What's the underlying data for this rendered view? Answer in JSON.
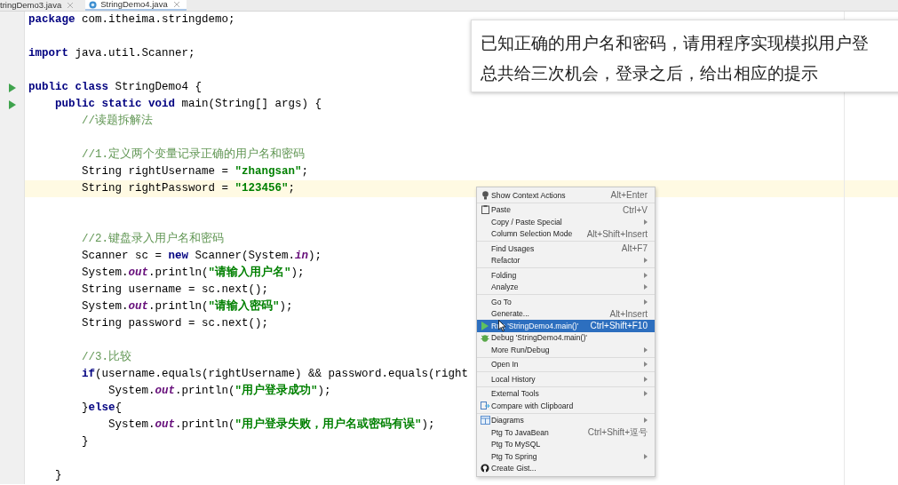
{
  "tabs": [
    {
      "label": "tringDemo3.java",
      "selected": false,
      "kind": "plain"
    },
    {
      "label": "StringDemo4.java",
      "selected": true,
      "kind": "class"
    }
  ],
  "code_lines": [
    {
      "current": false,
      "run_marker": false,
      "tokens": [
        {
          "text": "package",
          "kind": "keyword"
        },
        {
          "text": " com.itheima.stringdemo;",
          "kind": "plain"
        }
      ]
    },
    {
      "current": false,
      "run_marker": false
    },
    {
      "current": false,
      "run_marker": false,
      "tokens": [
        {
          "text": "import",
          "kind": "keyword"
        },
        {
          "text": " java.util.Scanner;",
          "kind": "plain"
        }
      ]
    },
    {
      "current": false,
      "run_marker": false
    },
    {
      "current": false,
      "run_marker": true,
      "tokens": [
        {
          "text": "public class",
          "kind": "keyword"
        },
        {
          "text": " StringDemo4 {",
          "kind": "plain"
        }
      ]
    },
    {
      "current": false,
      "run_marker": true,
      "tokens": [
        {
          "text": "    public static void",
          "kind": "keyword"
        },
        {
          "text": " main(String[] args) {",
          "kind": "plain"
        }
      ]
    },
    {
      "current": false,
      "run_marker": false,
      "tokens": [
        {
          "text": "        //读题拆解法",
          "kind": "comment"
        }
      ]
    },
    {
      "current": false,
      "run_marker": false
    },
    {
      "current": false,
      "run_marker": false,
      "tokens": [
        {
          "text": "        //1.定义两个变量记录正确的用户名和密码",
          "kind": "comment"
        }
      ]
    },
    {
      "current": false,
      "run_marker": false,
      "tokens": [
        {
          "text": "        String rightUsername = ",
          "kind": "plain"
        },
        {
          "text": "\"zhangsan\"",
          "kind": "string"
        },
        {
          "text": ";",
          "kind": "plain"
        }
      ]
    },
    {
      "current": true,
      "run_marker": false,
      "tokens": [
        {
          "text": "        String rightPassword = ",
          "kind": "plain"
        },
        {
          "text": "\"123456\"",
          "kind": "string"
        },
        {
          "text": ";",
          "kind": "plain"
        }
      ]
    },
    {
      "current": false,
      "run_marker": false
    },
    {
      "current": false,
      "run_marker": false
    },
    {
      "current": false,
      "run_marker": false,
      "tokens": [
        {
          "text": "        //2.键盘录入用户名和密码",
          "kind": "comment"
        }
      ]
    },
    {
      "current": false,
      "run_marker": false,
      "tokens": [
        {
          "text": "        Scanner sc = ",
          "kind": "plain"
        },
        {
          "text": "new",
          "kind": "keyword"
        },
        {
          "text": " Scanner(System.",
          "kind": "plain"
        },
        {
          "text": "in",
          "kind": "field"
        },
        {
          "text": ");",
          "kind": "plain"
        }
      ]
    },
    {
      "current": false,
      "run_marker": false,
      "tokens": [
        {
          "text": "        System.",
          "kind": "plain"
        },
        {
          "text": "out",
          "kind": "field"
        },
        {
          "text": ".println(",
          "kind": "plain"
        },
        {
          "text": "\"请输入用户名\"",
          "kind": "string"
        },
        {
          "text": ");",
          "kind": "plain"
        }
      ]
    },
    {
      "current": false,
      "run_marker": false,
      "tokens": [
        {
          "text": "        String username = sc.next();",
          "kind": "plain"
        }
      ]
    },
    {
      "current": false,
      "run_marker": false,
      "tokens": [
        {
          "text": "        System.",
          "kind": "plain"
        },
        {
          "text": "out",
          "kind": "field"
        },
        {
          "text": ".println(",
          "kind": "plain"
        },
        {
          "text": "\"请输入密码\"",
          "kind": "string"
        },
        {
          "text": ");",
          "kind": "plain"
        }
      ]
    },
    {
      "current": false,
      "run_marker": false,
      "tokens": [
        {
          "text": "        String password = sc.next();",
          "kind": "plain"
        }
      ]
    },
    {
      "current": false,
      "run_marker": false
    },
    {
      "current": false,
      "run_marker": false,
      "tokens": [
        {
          "text": "        //3.比较",
          "kind": "comment"
        }
      ]
    },
    {
      "current": false,
      "run_marker": false,
      "tokens": [
        {
          "text": "        if",
          "kind": "keyword"
        },
        {
          "text": "(username.equals(rightUsername) && password.equals(right",
          "kind": "plain"
        }
      ]
    },
    {
      "current": false,
      "run_marker": false,
      "tokens": [
        {
          "text": "            System.",
          "kind": "plain"
        },
        {
          "text": "out",
          "kind": "field"
        },
        {
          "text": ".println(",
          "kind": "plain"
        },
        {
          "text": "\"用户登录成功\"",
          "kind": "string"
        },
        {
          "text": ");",
          "kind": "plain"
        }
      ]
    },
    {
      "current": false,
      "run_marker": false,
      "tokens": [
        {
          "text": "        }",
          "kind": "plain"
        },
        {
          "text": "else",
          "kind": "keyword"
        },
        {
          "text": "{",
          "kind": "plain"
        }
      ]
    },
    {
      "current": false,
      "run_marker": false,
      "tokens": [
        {
          "text": "            System.",
          "kind": "plain"
        },
        {
          "text": "out",
          "kind": "field"
        },
        {
          "text": ".println(",
          "kind": "plain"
        },
        {
          "text": "\"用户登录失败，用户名或密码有误\"",
          "kind": "string"
        },
        {
          "text": ");",
          "kind": "plain"
        }
      ]
    },
    {
      "current": false,
      "run_marker": false,
      "tokens": [
        {
          "text": "        }",
          "kind": "plain"
        }
      ]
    },
    {
      "current": false,
      "run_marker": false
    },
    {
      "current": false,
      "run_marker": false,
      "tokens": [
        {
          "text": "    }",
          "kind": "plain"
        }
      ]
    }
  ],
  "callout": {
    "lines": [
      "已知正确的用户名和密码，请用程序实现模拟用户登",
      "总共给三次机会，登录之后，给出相应的提示"
    ]
  },
  "context_menu": {
    "groups": [
      [
        {
          "label": "Show Context Actions",
          "shortcut": "Alt+Enter",
          "kind": "bulb",
          "submenu": false,
          "selected": false
        }
      ],
      [
        {
          "label": "Paste",
          "shortcut": "Ctrl+V",
          "kind": "paste",
          "submenu": false,
          "selected": false
        },
        {
          "label": "Copy / Paste Special",
          "kind": "plain",
          "submenu": true,
          "selected": false
        },
        {
          "label": "Column Selection Mode",
          "shortcut": "Alt+Shift+Insert",
          "kind": "plain",
          "submenu": false,
          "selected": false
        }
      ],
      [
        {
          "label": "Find Usages",
          "shortcut": "Alt+F7",
          "kind": "plain",
          "submenu": false,
          "selected": false
        },
        {
          "label": "Refactor",
          "kind": "plain",
          "submenu": true,
          "selected": false
        }
      ],
      [
        {
          "label": "Folding",
          "kind": "plain",
          "submenu": true,
          "selected": false
        },
        {
          "label": "Analyze",
          "kind": "plain",
          "submenu": true,
          "selected": false
        }
      ],
      [
        {
          "label": "Go To",
          "kind": "plain",
          "submenu": true,
          "selected": false
        },
        {
          "label": "Generate...",
          "shortcut": "Alt+Insert",
          "kind": "plain",
          "submenu": false,
          "selected": false
        },
        {
          "label": "Run 'StringDemo4.main()'",
          "shortcut": "Ctrl+Shift+F10",
          "kind": "run",
          "submenu": false,
          "selected": true
        },
        {
          "label": "Debug 'StringDemo4.main()'",
          "kind": "debug",
          "submenu": false,
          "selected": false
        },
        {
          "label": "More Run/Debug",
          "kind": "plain",
          "submenu": true,
          "selected": false
        }
      ],
      [
        {
          "label": "Open In",
          "kind": "plain",
          "submenu": true,
          "selected": false
        }
      ],
      [
        {
          "label": "Local History",
          "kind": "plain",
          "submenu": true,
          "selected": false
        }
      ],
      [
        {
          "label": "External Tools",
          "kind": "plain",
          "submenu": true,
          "selected": false
        },
        {
          "label": "Compare with Clipboard",
          "kind": "compare",
          "submenu": false,
          "selected": false
        }
      ],
      [
        {
          "label": "Diagrams",
          "kind": "diagram",
          "submenu": true,
          "selected": false
        },
        {
          "label": "Ptg To JavaBean",
          "shortcut": "Ctrl+Shift+逗号",
          "kind": "plain",
          "submenu": false,
          "selected": false
        },
        {
          "label": "Ptg To MySQL",
          "kind": "plain",
          "submenu": false,
          "selected": false
        },
        {
          "label": "Ptg To Spring",
          "kind": "plain",
          "submenu": true,
          "selected": false
        },
        {
          "label": "Create Gist...",
          "kind": "gist",
          "submenu": false,
          "selected": false
        }
      ]
    ]
  }
}
